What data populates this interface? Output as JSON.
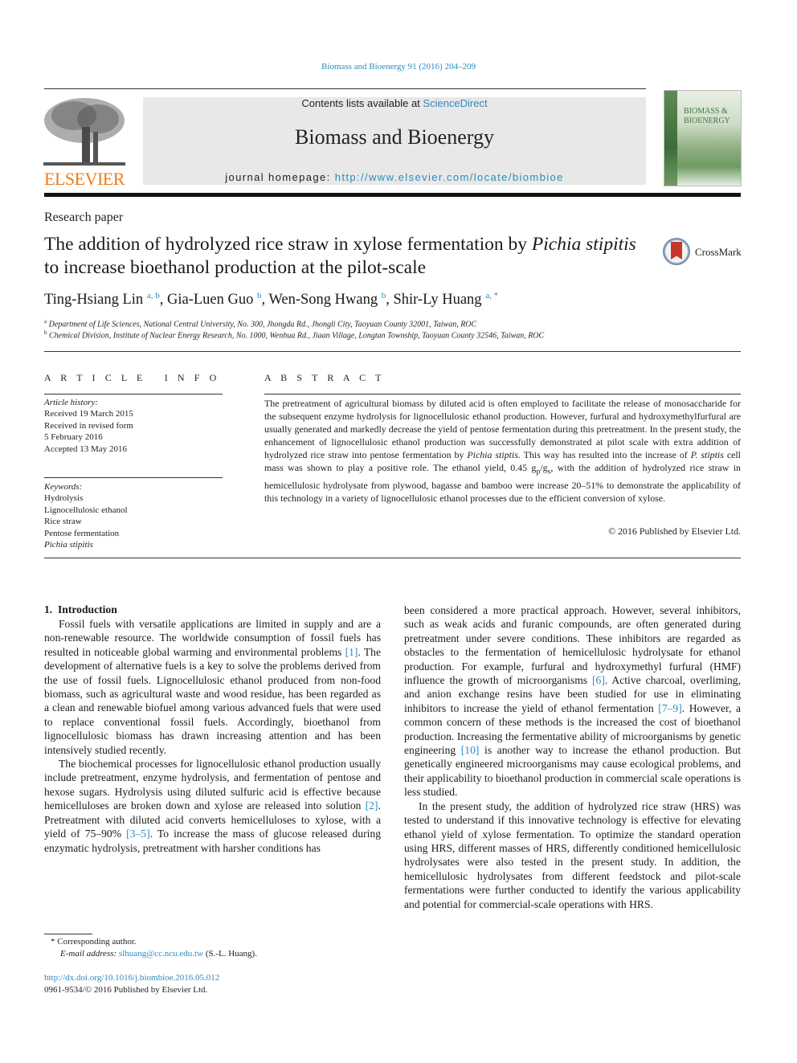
{
  "header": {
    "citation": "Biomass and Bioenergy 91 (2016) 204–209",
    "contents_prefix": "Contents lists available at ",
    "contents_link": "ScienceDirect",
    "journal_name": "Biomass and Bioenergy",
    "homepage_prefix": "journal homepage: ",
    "homepage_url": "http://www.elsevier.com/locate/biombioe",
    "publisher_wordmark": "ELSEVIER",
    "cover_title_line1": "BIOMASS &",
    "cover_title_line2": "BIOENERGY",
    "crossmark_label": "CrossMark",
    "colors": {
      "link": "#2b8bbd",
      "elsevier_orange": "#f07a1a",
      "header_bg": "#e8e8e8"
    }
  },
  "article": {
    "type": "Research paper",
    "title_part1": "The addition of hydrolyzed rice straw in xylose fermentation by ",
    "title_italic1": "Pichia stipitis",
    "title_part2": " to increase bioethanol production at the pilot-scale",
    "authors": [
      {
        "name": "Ting-Hsiang Lin",
        "affil": "a, b"
      },
      {
        "name": "Gia-Luen Guo",
        "affil": "b"
      },
      {
        "name": "Wen-Song Hwang",
        "affil": "b"
      },
      {
        "name": "Shir-Ly Huang",
        "affil": "a, *"
      }
    ],
    "affiliations": [
      {
        "mark": "a",
        "text": "Department of Life Sciences, National Central University, No. 300, Jhongda Rd., Jhongli City, Taoyuan County 32001, Taiwan, ROC"
      },
      {
        "mark": "b",
        "text": "Chemical Division, Institute of Nuclear Energy Research, No. 1000, Wenhua Rd., Jiaan Village, Longtan Township, Taoyuan County 32546, Taiwan, ROC"
      }
    ]
  },
  "article_info": {
    "heading": "A R T I C L E   I N F O",
    "history_label": "Article history:",
    "history": [
      "Received 19 March 2015",
      "Received in revised form",
      "5 February 2016",
      "Accepted 13 May 2016"
    ],
    "keywords_label": "Keywords:",
    "keywords": [
      "Hydrolysis",
      "Lignocellulosic ethanol",
      "Rice straw",
      "Pentose fermentation",
      "Pichia stipitis"
    ]
  },
  "abstract": {
    "heading": "A B S T R A C T",
    "p1": "The pretreatment of agricultural biomass by diluted acid is often employed to facilitate the release of monosaccharide for the subsequent enzyme hydrolysis for lignocellulosic ethanol production. However, furfural and hydroxymethylfurfural are usually generated and markedly decrease the yield of pentose fermentation during this pretreatment. In the present study, the enhancement of lignocellulosic ethanol production was successfully demonstrated at pilot scale with extra addition of hydrolyzed rice straw into pentose fermentation by ",
    "i1": "Pichia stiptis",
    "p2": ". This way has resulted into the increase of ",
    "i2": "P. stiptis",
    "p3": " cell mass was shown to play a positive role. The ethanol yield, 0.45 g",
    "sub_p": "p",
    "slash": "/g",
    "sub_s": "s",
    "p4": ", with the addition of hydrolyzed rice straw in hemicellulosic hydrolysate from plywood, bagasse and bamboo were increase 20–51% to demonstrate the applicability of this technology in a variety of lignocellulosic ethanol processes due to the efficient conversion of xylose.",
    "copyright": "© 2016 Published by Elsevier Ltd."
  },
  "intro": {
    "heading": "1.  Introduction",
    "left": {
      "p1a": "Fossil fuels with versatile applications are limited in supply and are a non-renewable resource. The worldwide consumption of fossil fuels has resulted in noticeable global warming and environmental problems ",
      "ref1": "[1]",
      "p1b": ". The development of alternative fuels is a key to solve the problems derived from the use of fossil fuels. Lignocellulosic ethanol produced from non-food biomass, such as agricultural waste and wood residue, has been regarded as a clean and renewable biofuel among various advanced fuels that were used to replace conventional fossil fuels. Accordingly, bioethanol from lignocellulosic biomass has drawn increasing attention and has been intensively studied recently.",
      "p2a": "The biochemical processes for lignocellulosic ethanol production usually include pretreatment, enzyme hydrolysis, and fermentation of pentose and hexose sugars. Hydrolysis using diluted sulfuric acid is effective because hemicelluloses are broken down and xylose are released into solution ",
      "ref2": "[2]",
      "p2b": ". Pretreatment with diluted acid converts hemicelluloses to xylose, with a yield of 75–90% ",
      "ref3": "[3–5]",
      "p2c": ". To increase the mass of glucose released during enzymatic hydrolysis, pretreatment with harsher conditions has"
    },
    "right": {
      "p1a": "been considered a more practical approach. However, several inhibitors, such as weak acids and furanic compounds, are often generated during pretreatment under severe conditions. These inhibitors are regarded as obstacles to the fermentation of hemicellulosic hydrolysate for ethanol production. For example, furfural and hydroxymethyl furfural (HMF) influence the growth of microorganisms ",
      "ref6": "[6]",
      "p1b": ". Active charcoal, overliming, and anion exchange resins have been studied for use in eliminating inhibitors to increase the yield of ethanol fermentation ",
      "ref7": "[7–9]",
      "p1c": ". However, a common concern of these methods is the increased the cost of bioethanol production. Increasing the fermentative ability of microorganisms by genetic engineering ",
      "ref10": "[10]",
      "p1d": " is another way to increase the ethanol production. But genetically engineered microorganisms may cause ecological problems, and their applicability to bioethanol production in commercial scale operations is less studied.",
      "p2": "In the present study, the addition of hydrolyzed rice straw (HRS) was tested to understand if this innovative technology is effective for elevating ethanol yield of xylose fermentation. To optimize the standard operation using HRS, different masses of HRS, differently conditioned hemicellulosic hydrolysates were also tested in the present study. In addition, the hemicellulosic hydrolysates from different feedstock and pilot-scale fermentations were further conducted to identify the various applicability and potential for commercial-scale operations with HRS."
    }
  },
  "footer": {
    "corresponding": "* Corresponding author.",
    "email_label": "E-mail address: ",
    "email": "slhuang@cc.ncu.edu.tw",
    "email_suffix": " (S.-L. Huang).",
    "doi": "http://dx.doi.org/10.1016/j.biombioe.2016.05.012",
    "issn": "0961-9534/© 2016 Published by Elsevier Ltd."
  }
}
